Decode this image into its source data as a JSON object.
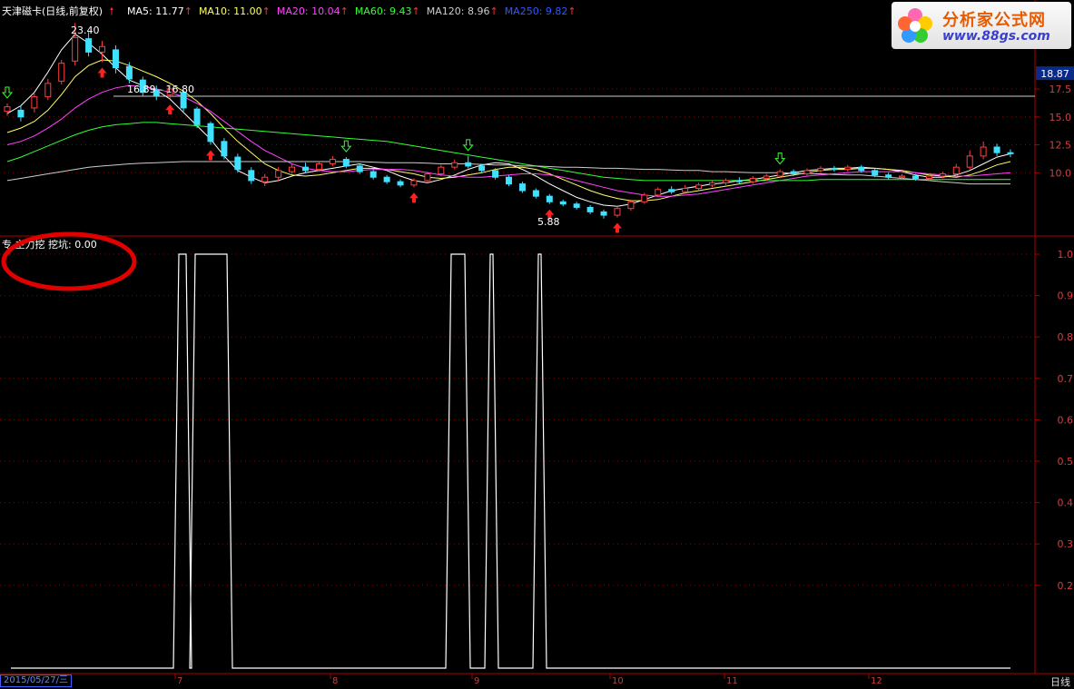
{
  "header": {
    "title": "天津磁卡(日线,前复权)",
    "ma": [
      {
        "label": "MA5: 11.77",
        "color": "#ffffff"
      },
      {
        "label": "MA10: 11.00",
        "color": "#ffff66"
      },
      {
        "label": "MA20: 10.04",
        "color": "#ff44ff"
      },
      {
        "label": "MA60: 9.43",
        "color": "#33ff33"
      },
      {
        "label": "MA120: 8.96",
        "color": "#cccccc"
      },
      {
        "label": "MA250: 9.82",
        "color": "#3355ff"
      }
    ]
  },
  "logo": {
    "text": "分析家公式网",
    "url_text": "www.88gs.com"
  },
  "indicator": {
    "label": "主力挖",
    "value_text": "挖坑: 0.00",
    "prefix": "专"
  },
  "date_box": "2015/05/27/三",
  "period_label": "日线",
  "colors": {
    "up": "#ff4040",
    "down": "#40e0ff",
    "grid": "#8b0000",
    "axis": "#b00000"
  },
  "chart_data": [
    {
      "type": "candlestick",
      "annotations": [
        "23.40",
        "16.89 - 16.80",
        "5.88"
      ],
      "current_price_tag": "18.87",
      "y_ticks": [
        "17.5",
        "15.0",
        "12.5",
        "10.0"
      ],
      "ylim": [
        4.5,
        24
      ],
      "x_labels": [
        "7",
        "8",
        "9",
        "10",
        "11",
        "12"
      ],
      "ma_series": [
        {
          "name": "MA5",
          "values": [
            15.3,
            16,
            17.2,
            19,
            21,
            22.4,
            21.6,
            20.6,
            19.4,
            18.3,
            17.8,
            17.4,
            16.6,
            15.4,
            14.2,
            13,
            11.5,
            10.2,
            9.6,
            9.1,
            9.3,
            9.7,
            10,
            10.2,
            10.4,
            10.6,
            10.8,
            10.5,
            10.2,
            9.7,
            9.3,
            9.1,
            9.4,
            9.8,
            10.3,
            10.7,
            10.9,
            10.8,
            10.3,
            9.7,
            9,
            8.4,
            7.8,
            7.4,
            7.1,
            7,
            7.2,
            7.6,
            8,
            8.4,
            8.6,
            8.8,
            9,
            9.1,
            9.3,
            9.4,
            9.6,
            9.8,
            10,
            10.2,
            10.3,
            10.4,
            10.4,
            10.5,
            10.4,
            10.3,
            10.1,
            9.8,
            9.6,
            9.6,
            9.8,
            10.2,
            10.8,
            11.4,
            11.7
          ]
        },
        {
          "name": "MA10",
          "values": [
            13.6,
            14,
            14.6,
            15.6,
            17,
            18.6,
            19.6,
            20.1,
            20,
            19.6,
            19.1,
            18.6,
            18,
            17.3,
            16.4,
            15.3,
            14,
            12.8,
            11.8,
            10.8,
            10.2,
            9.8,
            9.7,
            9.8,
            10,
            10.2,
            10.4,
            10.4,
            10.3,
            10.1,
            9.9,
            9.6,
            9.5,
            9.6,
            9.8,
            10,
            10.3,
            10.5,
            10.5,
            10.3,
            9.9,
            9.4,
            8.9,
            8.4,
            8,
            7.7,
            7.5,
            7.5,
            7.6,
            7.9,
            8.2,
            8.4,
            8.6,
            8.8,
            9,
            9.2,
            9.4,
            9.6,
            9.8,
            10,
            10.2,
            10.3,
            10.3,
            10.4,
            10.4,
            10.3,
            10.2,
            10,
            9.8,
            9.7,
            9.6,
            9.8,
            10.2,
            10.7,
            11
          ]
        },
        {
          "name": "MA20",
          "values": [
            12.5,
            12.8,
            13.3,
            14,
            14.8,
            15.8,
            16.6,
            17.2,
            17.6,
            17.8,
            17.7,
            17.5,
            17.2,
            16.8,
            16.2,
            15.5,
            14.6,
            13.7,
            12.8,
            12,
            11.4,
            10.8,
            10.4,
            10.2,
            10.1,
            10.1,
            10.2,
            10.3,
            10.3,
            10.3,
            10.2,
            10,
            9.8,
            9.7,
            9.6,
            9.6,
            9.7,
            9.8,
            9.9,
            9.9,
            9.8,
            9.6,
            9.3,
            9,
            8.7,
            8.4,
            8.2,
            8,
            7.9,
            7.9,
            8,
            8.1,
            8.3,
            8.5,
            8.7,
            8.9,
            9.1,
            9.3,
            9.5,
            9.7,
            9.8,
            9.9,
            10,
            10.1,
            10.1,
            10.1,
            10.1,
            10,
            9.9,
            9.8,
            9.7,
            9.7,
            9.8,
            9.9,
            10
          ]
        },
        {
          "name": "MA60",
          "values": [
            11,
            11.4,
            11.9,
            12.4,
            12.9,
            13.4,
            13.8,
            14.1,
            14.3,
            14.4,
            14.5,
            14.5,
            14.4,
            14.3,
            14.2,
            14.1,
            14,
            13.9,
            13.8,
            13.7,
            13.6,
            13.5,
            13.4,
            13.3,
            13.2,
            13.1,
            13,
            12.9,
            12.8,
            12.6,
            12.4,
            12.2,
            12,
            11.8,
            11.6,
            11.4,
            11.2,
            11,
            10.8,
            10.6,
            10.4,
            10.2,
            10,
            9.8,
            9.6,
            9.5,
            9.4,
            9.3,
            9.3,
            9.3,
            9.3,
            9.3,
            9.3,
            9.3,
            9.3,
            9.3,
            9.3,
            9.3,
            9.3,
            9.3,
            9.4,
            9.4,
            9.4,
            9.4,
            9.4,
            9.4,
            9.4,
            9.4,
            9.4,
            9.4,
            9.4,
            9.4,
            9.4,
            9.4,
            9.4
          ]
        },
        {
          "name": "MA120",
          "values": [
            9.3,
            9.5,
            9.7,
            9.9,
            10.1,
            10.3,
            10.5,
            10.6,
            10.7,
            10.8,
            10.85,
            10.9,
            10.95,
            11,
            11,
            11,
            11,
            11,
            11,
            11,
            11,
            11,
            11,
            11,
            11,
            11,
            11,
            10.95,
            10.9,
            10.9,
            10.9,
            10.85,
            10.8,
            10.8,
            10.8,
            10.75,
            10.7,
            10.7,
            10.6,
            10.6,
            10.55,
            10.5,
            10.5,
            10.45,
            10.4,
            10.4,
            10.35,
            10.3,
            10.3,
            10.25,
            10.2,
            10.2,
            10.1,
            10.1,
            10.05,
            10,
            10,
            10,
            9.95,
            9.9,
            9.9,
            9.85,
            9.8,
            9.8,
            9.7,
            9.6,
            9.5,
            9.4,
            9.3,
            9.2,
            9.1,
            9,
            9,
            9,
            9
          ]
        }
      ],
      "arrows_up_red": [
        7,
        12,
        15,
        30,
        40,
        45
      ],
      "arrows_down_green": [
        0,
        25,
        34,
        57
      ],
      "candles": [
        {
          "o": 15.5,
          "c": 15.9,
          "h": 16.2,
          "l": 15.1
        },
        {
          "o": 15.6,
          "c": 15,
          "h": 16,
          "l": 14.6
        },
        {
          "o": 15.8,
          "c": 16.8,
          "h": 17.1,
          "l": 15.4
        },
        {
          "o": 16.8,
          "c": 18,
          "h": 18.4,
          "l": 16.5
        },
        {
          "o": 18.2,
          "c": 19.8,
          "h": 20.1,
          "l": 17.9
        },
        {
          "o": 20,
          "c": 22.1,
          "h": 23.4,
          "l": 19.6
        },
        {
          "o": 22,
          "c": 20.8,
          "h": 22.6,
          "l": 20.4
        },
        {
          "o": 20.8,
          "c": 21.3,
          "h": 21.8,
          "l": 19.9
        },
        {
          "o": 21,
          "c": 19.4,
          "h": 21.4,
          "l": 18.9
        },
        {
          "o": 19.5,
          "c": 18.4,
          "h": 19.9,
          "l": 18
        },
        {
          "o": 18.3,
          "c": 17.2,
          "h": 18.6,
          "l": 16.9
        },
        {
          "o": 17.4,
          "c": 16.9,
          "h": 17.8,
          "l": 16.5
        },
        {
          "o": 17,
          "c": 17.5,
          "h": 17.9,
          "l": 16.6
        },
        {
          "o": 17.2,
          "c": 15.8,
          "h": 17.4,
          "l": 15.5
        },
        {
          "o": 15.7,
          "c": 14.3,
          "h": 15.9,
          "l": 14
        },
        {
          "o": 14.4,
          "c": 12.8,
          "h": 14.6,
          "l": 12.5
        },
        {
          "o": 12.8,
          "c": 11.5,
          "h": 13.1,
          "l": 11.2
        },
        {
          "o": 11.4,
          "c": 10.3,
          "h": 11.7,
          "l": 10
        },
        {
          "o": 10.2,
          "c": 9.3,
          "h": 10.5,
          "l": 9
        },
        {
          "o": 9.2,
          "c": 9.6,
          "h": 9.9,
          "l": 8.8
        },
        {
          "o": 9.6,
          "c": 10.2,
          "h": 10.5,
          "l": 9.3
        },
        {
          "o": 10.1,
          "c": 10.5,
          "h": 10.8,
          "l": 9.9
        },
        {
          "o": 10.5,
          "c": 10.2,
          "h": 10.9,
          "l": 10
        },
        {
          "o": 10.3,
          "c": 10.8,
          "h": 11,
          "l": 10.1
        },
        {
          "o": 10.8,
          "c": 11.2,
          "h": 11.5,
          "l": 10.6
        },
        {
          "o": 11.2,
          "c": 10.6,
          "h": 11.4,
          "l": 10.4
        },
        {
          "o": 10.6,
          "c": 10.1,
          "h": 10.8,
          "l": 9.9
        },
        {
          "o": 10.1,
          "c": 9.6,
          "h": 10.3,
          "l": 9.4
        },
        {
          "o": 9.6,
          "c": 9.2,
          "h": 9.8,
          "l": 9
        },
        {
          "o": 9.2,
          "c": 8.9,
          "h": 9.4,
          "l": 8.7
        },
        {
          "o": 8.9,
          "c": 9.3,
          "h": 9.5,
          "l": 8.7
        },
        {
          "o": 9.3,
          "c": 9.9,
          "h": 10.1,
          "l": 9.1
        },
        {
          "o": 9.9,
          "c": 10.5,
          "h": 10.7,
          "l": 9.7
        },
        {
          "o": 10.5,
          "c": 10.9,
          "h": 11.2,
          "l": 10.3
        },
        {
          "o": 10.9,
          "c": 10.6,
          "h": 11.5,
          "l": 10.4
        },
        {
          "o": 10.6,
          "c": 10.2,
          "h": 10.8,
          "l": 10
        },
        {
          "o": 10.2,
          "c": 9.6,
          "h": 10.4,
          "l": 9.4
        },
        {
          "o": 9.6,
          "c": 9,
          "h": 9.8,
          "l": 8.8
        },
        {
          "o": 9,
          "c": 8.4,
          "h": 9.2,
          "l": 8.2
        },
        {
          "o": 8.4,
          "c": 7.9,
          "h": 8.6,
          "l": 7.7
        },
        {
          "o": 7.9,
          "c": 7.4,
          "h": 8.1,
          "l": 7.2
        },
        {
          "o": 7.4,
          "c": 7.2,
          "h": 7.6,
          "l": 7
        },
        {
          "o": 7.2,
          "c": 6.9,
          "h": 7.4,
          "l": 6.7
        },
        {
          "o": 6.9,
          "c": 6.5,
          "h": 7.1,
          "l": 6.3
        },
        {
          "o": 6.5,
          "c": 6.2,
          "h": 6.7,
          "l": 5.9
        },
        {
          "o": 6.2,
          "c": 6.8,
          "h": 7,
          "l": 6
        },
        {
          "o": 6.8,
          "c": 7.4,
          "h": 7.6,
          "l": 6.6
        },
        {
          "o": 7.4,
          "c": 8,
          "h": 8.2,
          "l": 7.2
        },
        {
          "o": 8,
          "c": 8.5,
          "h": 8.7,
          "l": 7.8
        },
        {
          "o": 8.5,
          "c": 8.3,
          "h": 8.8,
          "l": 8.1
        },
        {
          "o": 8.3,
          "c": 8.6,
          "h": 8.9,
          "l": 8.1
        },
        {
          "o": 8.6,
          "c": 8.9,
          "h": 9.1,
          "l": 8.4
        },
        {
          "o": 8.9,
          "c": 9.1,
          "h": 9.3,
          "l": 8.7
        },
        {
          "o": 9.1,
          "c": 9.3,
          "h": 9.5,
          "l": 8.9
        },
        {
          "o": 9.3,
          "c": 9.2,
          "h": 9.6,
          "l": 9
        },
        {
          "o": 9.2,
          "c": 9.5,
          "h": 9.7,
          "l": 9
        },
        {
          "o": 9.5,
          "c": 9.7,
          "h": 9.9,
          "l": 9.3
        },
        {
          "o": 9.7,
          "c": 10.1,
          "h": 10.3,
          "l": 9.5
        },
        {
          "o": 10.1,
          "c": 9.9,
          "h": 10.3,
          "l": 9.7
        },
        {
          "o": 9.9,
          "c": 10.2,
          "h": 10.4,
          "l": 9.7
        },
        {
          "o": 10.2,
          "c": 10.4,
          "h": 10.6,
          "l": 10
        },
        {
          "o": 10.4,
          "c": 10.3,
          "h": 10.6,
          "l": 10.1
        },
        {
          "o": 10.3,
          "c": 10.5,
          "h": 10.7,
          "l": 10.1
        },
        {
          "o": 10.5,
          "c": 10.2,
          "h": 10.7,
          "l": 10
        },
        {
          "o": 10.2,
          "c": 9.8,
          "h": 10.4,
          "l": 9.6
        },
        {
          "o": 9.8,
          "c": 9.6,
          "h": 10,
          "l": 9.4
        },
        {
          "o": 9.6,
          "c": 9.7,
          "h": 9.9,
          "l": 9.4
        },
        {
          "o": 9.7,
          "c": 9.5,
          "h": 9.9,
          "l": 9.3
        },
        {
          "o": 9.5,
          "c": 9.7,
          "h": 9.9,
          "l": 9.3
        },
        {
          "o": 9.7,
          "c": 9.9,
          "h": 10.1,
          "l": 9.5
        },
        {
          "o": 9.9,
          "c": 10.5,
          "h": 10.8,
          "l": 9.7
        },
        {
          "o": 10.5,
          "c": 11.5,
          "h": 12,
          "l": 10.3
        },
        {
          "o": 11.5,
          "c": 12.3,
          "h": 12.8,
          "l": 11.2
        },
        {
          "o": 12.3,
          "c": 11.8,
          "h": 12.6,
          "l": 11.5
        },
        {
          "o": 11.8,
          "c": 11.7,
          "h": 12.1,
          "l": 11.4
        }
      ]
    },
    {
      "type": "line",
      "series_label": "挖坑",
      "ylim": [
        0,
        1.0
      ],
      "y_ticks": [
        "1.0",
        "0.9",
        "0.8",
        "0.7",
        "0.6",
        "0.5",
        "0.4",
        "0.3",
        "0.2"
      ],
      "high_spans": [
        [
          197,
          205
        ],
        [
          215,
          250
        ],
        [
          497,
          512
        ],
        [
          540,
          543
        ],
        [
          593,
          596
        ]
      ],
      "baseline_x": [
        12,
        1113
      ]
    }
  ]
}
